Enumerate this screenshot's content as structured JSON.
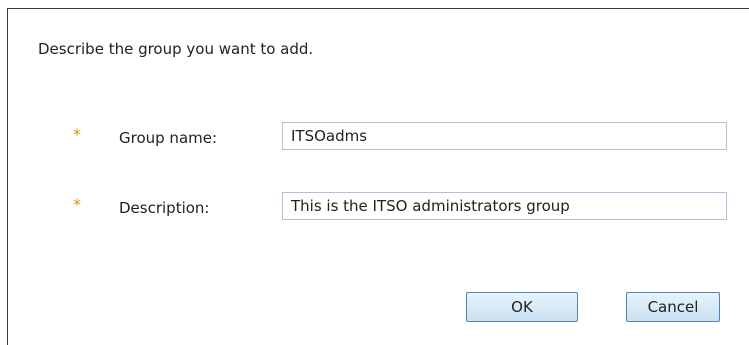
{
  "dialog": {
    "instruction": "Describe the group you want to add."
  },
  "form": {
    "required_marker": "*",
    "group_name": {
      "label": "Group name:",
      "value": "ITSOadms"
    },
    "description": {
      "label": "Description:",
      "value": "This is the ITSO administrators group"
    }
  },
  "buttons": {
    "ok_label": "OK",
    "cancel_label": "Cancel"
  },
  "colors": {
    "required_marker": "#e8900c",
    "field_border": "#a9c3dc",
    "button_border": "#4f86b7"
  }
}
